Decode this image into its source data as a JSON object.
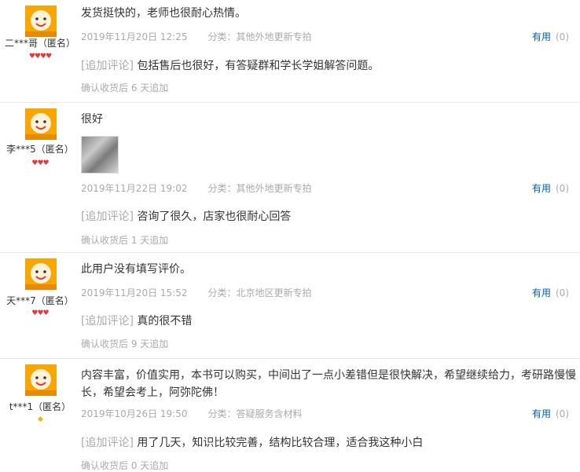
{
  "reviews": [
    {
      "user": "二***哥（匿名）",
      "level": "hearts4",
      "text": "发货挺快的，老师也很耐心热情。",
      "date": "2019年11月20日 12:25",
      "category": "分类：其他外地更新专拍",
      "useful_label": "有用",
      "useful_count": "(0)",
      "append_tag": "[追加评论]",
      "append_text": "包括售后也很好，有答疑群和学长学姐解答问题。",
      "append_meta": "确认收货后 6 天追加"
    },
    {
      "user": "李***5（匿名）",
      "level": "hearts3",
      "text": "很好",
      "has_image": true,
      "date": "2019年11月22日 19:02",
      "category": "分类：其他外地更新专拍",
      "useful_label": "有用",
      "useful_count": "(0)",
      "append_tag": "[追加评论]",
      "append_text": "咨询了很久，店家也很耐心回答",
      "append_meta": "确认收货后 1 天追加"
    },
    {
      "user": "天***7（匿名）",
      "level": "hearts3",
      "text": "此用户没有填写评价。",
      "date": "2019年11月20日 15:52",
      "category": "分类：北京地区更新专拍",
      "useful_label": "有用",
      "useful_count": "(0)",
      "append_tag": "[追加评论]",
      "append_text": "真的很不错",
      "append_meta": "确认收货后 9 天追加"
    },
    {
      "user": "t***1（匿名）",
      "level": "diamond1",
      "text_line1": "内容丰富，价值实用，本书可以购买，中间出了一点小差错但是很快解决，希望继续给力，考研路慢慢",
      "text_line2": "长，希望会考上，阿弥陀佛！",
      "date": "2019年10月26日 19:50",
      "category": "分类：答疑服务含材料",
      "useful_label": "有用",
      "useful_count": "(0)",
      "append_tag": "[追加评论]",
      "append_text": "用了几天，知识比较完善，结构比较合理，适合我这种小白",
      "append_meta": "确认收货后 0 天追加"
    }
  ],
  "colors": {
    "link": "#005ea7",
    "muted": "#aaaaaa",
    "heart": "#e4393c",
    "avatar": "#f59a00"
  }
}
